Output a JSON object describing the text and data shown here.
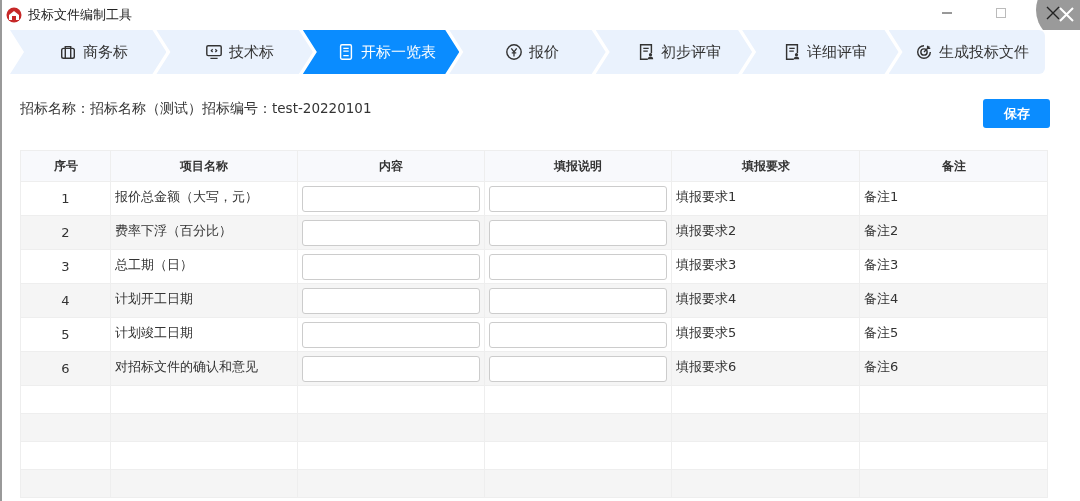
{
  "window": {
    "title": "投标文件编制工具"
  },
  "steps": [
    {
      "label": "商务标",
      "selected": false
    },
    {
      "label": "技术标",
      "selected": false
    },
    {
      "label": "开标一览表",
      "selected": true
    },
    {
      "label": "报价",
      "selected": false
    },
    {
      "label": "初步评审",
      "selected": false
    },
    {
      "label": "详细评审",
      "selected": false
    },
    {
      "label": "生成投标文件",
      "selected": false
    }
  ],
  "info": [
    {
      "label": "招标名称：",
      "value": "招标名称（测试）"
    },
    {
      "label": "招标编号：",
      "value": "test-20220101"
    }
  ],
  "save_button": "保存",
  "table": {
    "columns": [
      "序号",
      "项目名称",
      "内容",
      "填报说明",
      "填报要求",
      "备注"
    ],
    "rows": [
      {
        "no": "1",
        "name": "报价总金额（大写，元）",
        "requirement": "填报要求1",
        "remark": "备注1"
      },
      {
        "no": "2",
        "name": "费率下浮（百分比）",
        "requirement": "填报要求2",
        "remark": "备注2"
      },
      {
        "no": "3",
        "name": "总工期（日）",
        "requirement": "填报要求3",
        "remark": "备注3"
      },
      {
        "no": "4",
        "name": "计划开工日期",
        "requirement": "填报要求4",
        "remark": "备注4"
      },
      {
        "no": "5",
        "name": "计划竣工日期",
        "requirement": "填报要求5",
        "remark": "备注5"
      },
      {
        "no": "6",
        "name": "对招标文件的确认和意见",
        "requirement": "填报要求6",
        "remark": "备注6"
      }
    ]
  }
}
